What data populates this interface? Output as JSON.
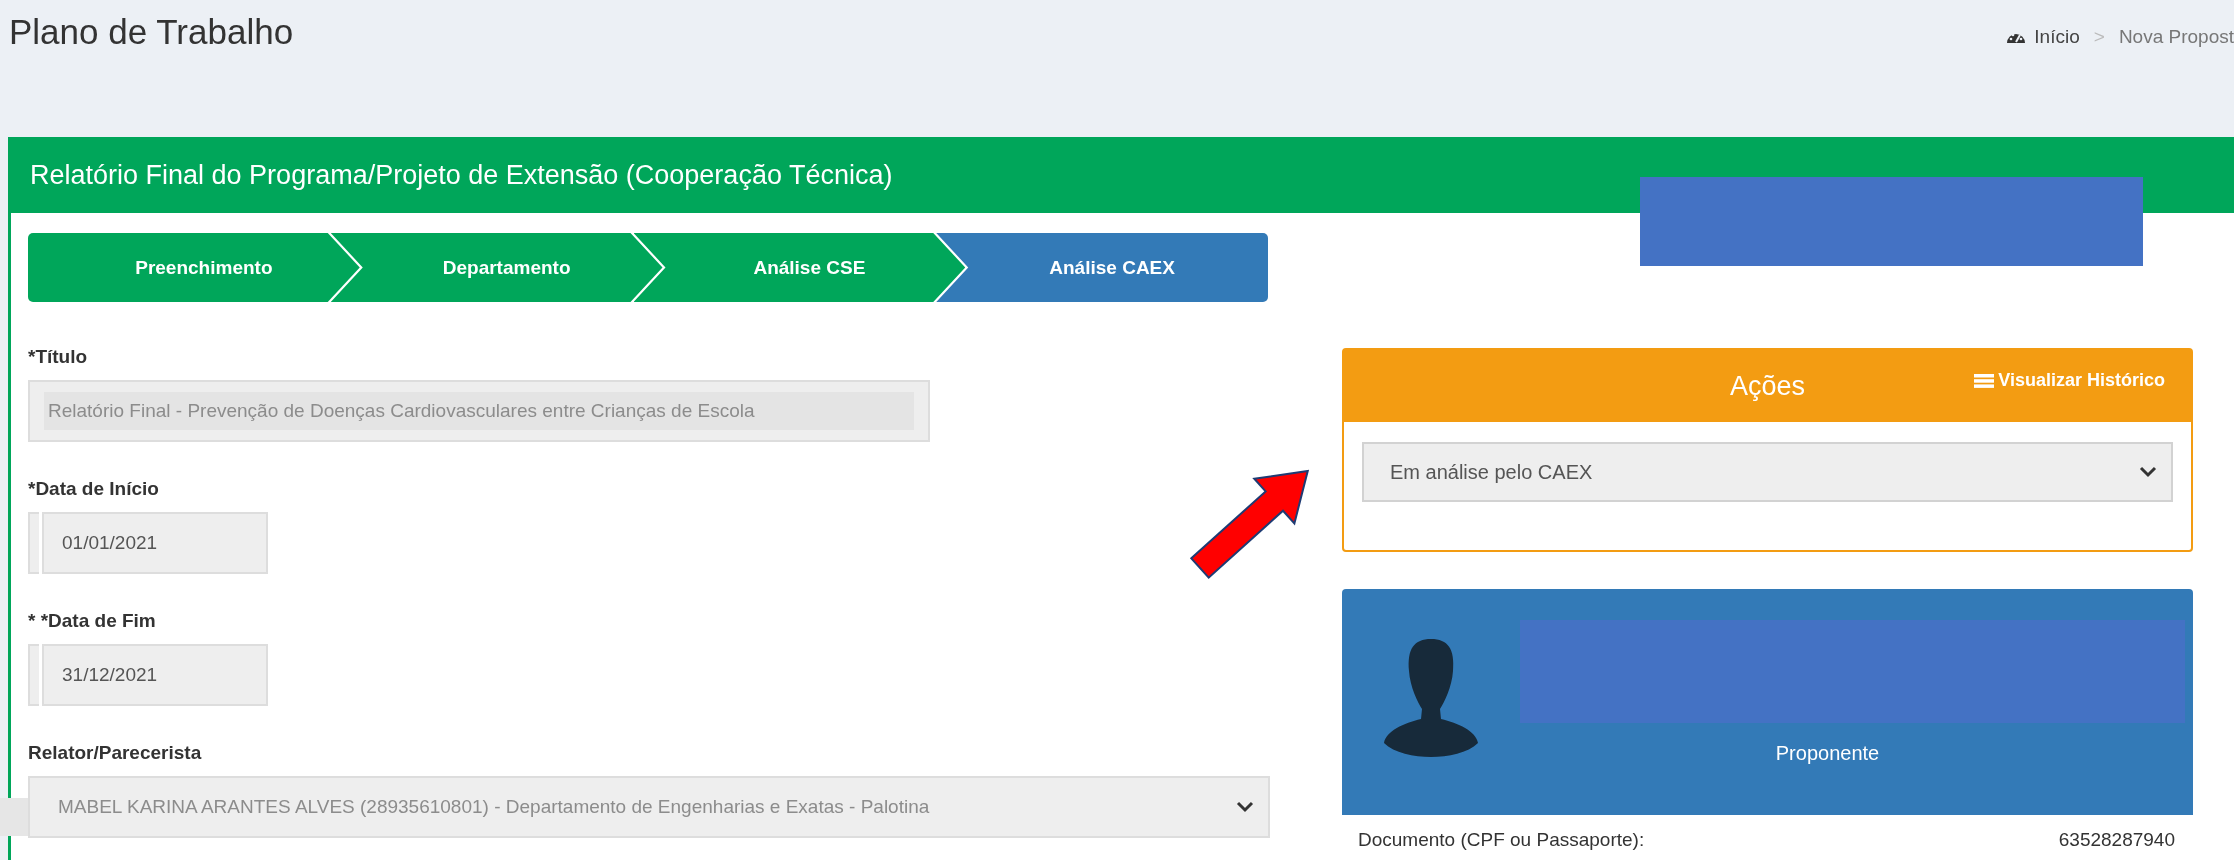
{
  "page_title": "Plano de Trabalho",
  "breadcrumb": [
    {
      "label": "Início",
      "kind": "home"
    },
    {
      "label": "Nova Propost",
      "kind": "page"
    }
  ],
  "breadcrumb_separator": ">",
  "panel": {
    "title": "Relatório Final do Programa/Projeto de Extensão (Cooperação Técnica)"
  },
  "steps": [
    {
      "label": "Preenchimento",
      "selected": false
    },
    {
      "label": "Departamento",
      "selected": false
    },
    {
      "label": "Análise CSE",
      "selected": false
    },
    {
      "label": "Análise CAEX",
      "selected": true
    }
  ],
  "fields": [
    {
      "label": "*Título",
      "value": "Relatório Final - Prevenção de Doenças Cardiovasculares entre Crianças de Escola",
      "kind": "text",
      "disabled": true
    },
    {
      "label": "*Data de Início",
      "value": "01/01/2021",
      "kind": "date",
      "disabled": false
    },
    {
      "label": "* *Data de Fim",
      "value": "31/12/2021",
      "kind": "date",
      "disabled": false
    },
    {
      "label": "Relator/Parecerista",
      "value": "MABEL KARINA ARANTES ALVES (28935610801) - Departamento de Engenharias e Exatas - Palotina",
      "kind": "select",
      "disabled": true
    }
  ],
  "actions": {
    "title": "Ações",
    "history_link": "Visualizar Histórico",
    "status_select": "Em análise pelo CAEX"
  },
  "profile": {
    "role": "Proponente",
    "rows": [
      {
        "label": "Documento (CPF ou Passaporte):",
        "value": "63528287940"
      }
    ]
  }
}
